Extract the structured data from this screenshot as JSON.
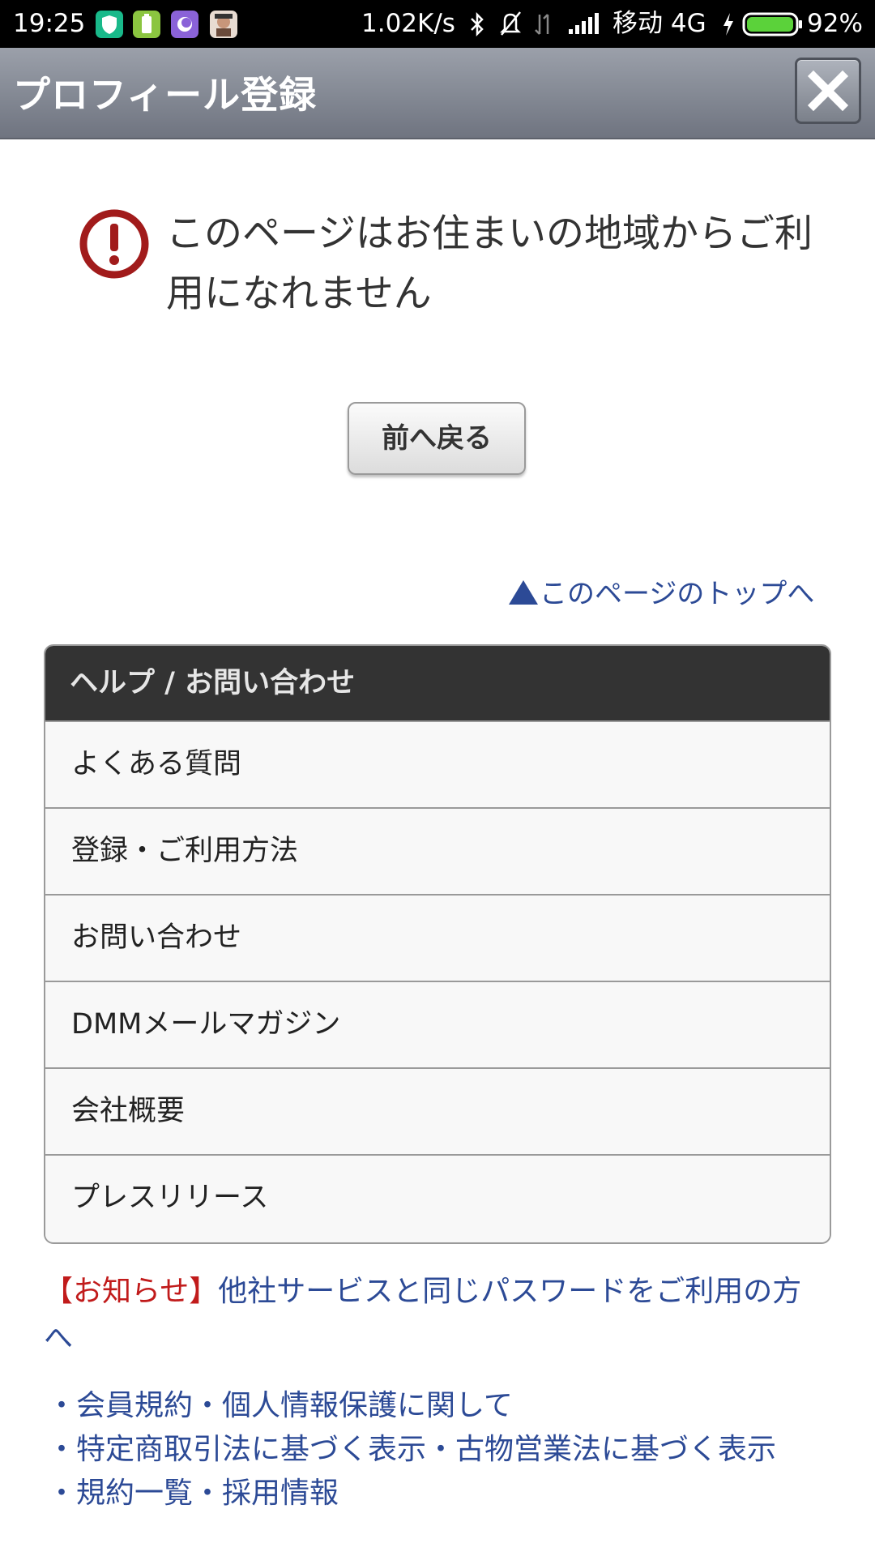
{
  "status_bar": {
    "time": "19:25",
    "network_speed": "1.02K/s",
    "carrier": "移动 4G",
    "battery": "92%",
    "icons": [
      "shield-app-icon",
      "battery-app-icon",
      "purple-app-icon",
      "game-avatar-icon",
      "bluetooth-icon",
      "mute-icon",
      "data-arrows-icon",
      "signal-icon",
      "charging-icon",
      "battery-icon"
    ]
  },
  "header": {
    "title": "プロフィール登録",
    "close_icon": "close-icon"
  },
  "message": {
    "icon": "alert-icon",
    "text": "このページはお住まいの地域からご利用になれません"
  },
  "back_button": {
    "label": "前へ戻る"
  },
  "top_link": {
    "label": "このページのトップへ"
  },
  "help": {
    "title": "ヘルプ / お問い合わせ",
    "items": [
      {
        "label": "よくある質問"
      },
      {
        "label": "登録・ご利用方法"
      },
      {
        "label": "お問い合わせ"
      },
      {
        "label": "DMMメールマガジン"
      },
      {
        "label": "会社概要"
      },
      {
        "label": "プレスリリース"
      }
    ]
  },
  "notice": {
    "tag": "【お知らせ】",
    "text": "他社サービスと同じパスワードをご利用の方へ"
  },
  "footer_links": [
    "・会員規約・個人情報保護に関して",
    "・特定商取引法に基づく表示・古物営業法に基づく表示",
    "・規約一覧・採用情報"
  ],
  "colors": {
    "header_gradient_top": "#9ba0aa",
    "header_gradient_bottom": "#6f7480",
    "alert_red": "#a11b1b",
    "link_blue": "#2c4a96",
    "notice_red": "#c11b1b",
    "help_header_bg": "#333333"
  }
}
